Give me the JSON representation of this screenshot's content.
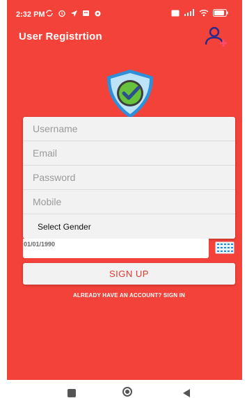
{
  "status_bar": {
    "time": "2:32 PM",
    "left_icons": [
      "sync-icon",
      "alarm-icon",
      "navigation-icon",
      "message-icon",
      "settings-icon"
    ],
    "right_icons": [
      "data-saver-icon",
      "signal-icon",
      "wifi-icon",
      "battery-icon"
    ],
    "battery": "76"
  },
  "header": {
    "title": "User Registrtion",
    "action_icon": "add-user-icon"
  },
  "logo": {
    "icon": "shield-check-icon"
  },
  "form": {
    "username_placeholder": "Username",
    "email_placeholder": "Email",
    "password_placeholder": "Password",
    "mobile_placeholder": "Mobile",
    "gender_label": "Select Gender",
    "date_value": "01/01/1990",
    "calendar_icon": "calendar-icon"
  },
  "actions": {
    "signup_label": "SIGN UP",
    "signin_link": "ALREADY HAVE AN ACCOUNT?  SIGN IN"
  },
  "colors": {
    "primary": "#f2423a",
    "button_text": "#e2382f",
    "card": "#f2f2f2"
  },
  "nav": {
    "icons": [
      "recent-apps-icon",
      "home-icon",
      "back-icon"
    ]
  }
}
